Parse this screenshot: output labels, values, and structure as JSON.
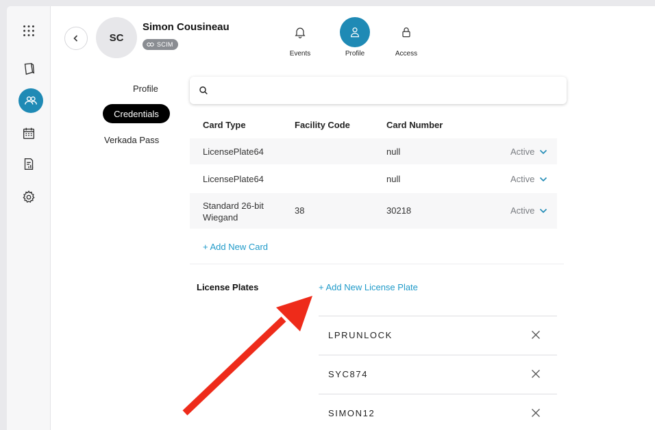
{
  "user": {
    "initials": "SC",
    "name": "Simon Cousineau",
    "badge": "SCIM"
  },
  "top_tabs": [
    {
      "label": "Events",
      "icon": "bell-icon",
      "active": false
    },
    {
      "label": "Profile",
      "icon": "person-icon",
      "active": true
    },
    {
      "label": "Access",
      "icon": "lock-icon",
      "active": false
    }
  ],
  "subnav": {
    "profile": "Profile",
    "credentials": "Credentials",
    "verkada_pass": "Verkada Pass"
  },
  "search": {
    "placeholder": "",
    "value": ""
  },
  "cards_table": {
    "headers": {
      "card_type": "Card Type",
      "facility_code": "Facility Code",
      "card_number": "Card Number"
    },
    "rows": [
      {
        "card_type": "LicensePlate64",
        "facility_code": "",
        "card_number": "null",
        "status": "Active"
      },
      {
        "card_type": "LicensePlate64",
        "facility_code": "",
        "card_number": "null",
        "status": "Active"
      },
      {
        "card_type": "Standard 26-bit Wiegand",
        "facility_code": "38",
        "card_number": "30218",
        "status": "Active"
      }
    ],
    "add_card_label": "+ Add New Card"
  },
  "license_plates": {
    "title": "License Plates",
    "add_label": "+ Add New License Plate",
    "plates": [
      "LPRUNLOCK",
      "SYC874",
      "SIMON12"
    ]
  },
  "colors": {
    "accent": "#1f8ab5",
    "link": "#1f9ac9",
    "annotation_arrow": "#ee2b1a"
  }
}
